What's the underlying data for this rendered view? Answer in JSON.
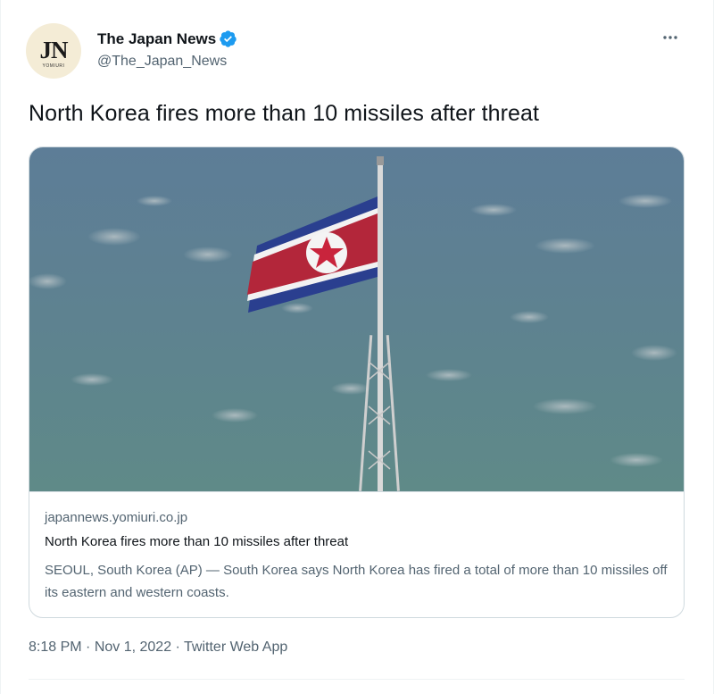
{
  "account": {
    "display_name": "The Japan News",
    "handle": "@The_Japan_News",
    "avatar_text": "JN",
    "avatar_subtext": "YOMIURI",
    "verified": true
  },
  "tweet": {
    "text": "North Korea fires more than 10 missiles after threat"
  },
  "card": {
    "image_icon": "north-korean-flag-photo",
    "domain": "japannews.yomiuri.co.jp",
    "title": "North Korea fires more than 10 missiles after threat",
    "description": "SEOUL, South Korea (AP) — South Korea says North Korea has fired a total of more than 10 missiles off its eastern and western coasts."
  },
  "meta": {
    "time": "8:18 PM",
    "separator": " · ",
    "date": "Nov 1, 2022",
    "source": "Twitter Web App"
  },
  "colors": {
    "accent": "#1d9bf0",
    "text_primary": "#0f1419",
    "text_secondary": "#536471",
    "border": "#cfd9de"
  }
}
